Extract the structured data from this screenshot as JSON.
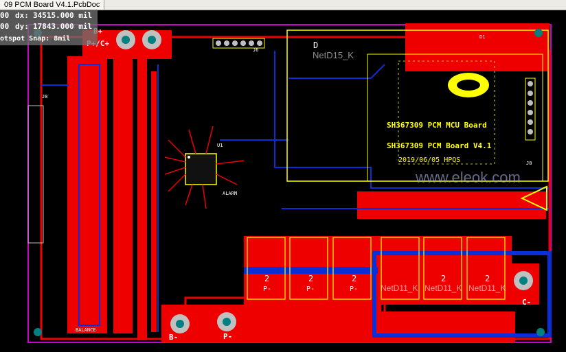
{
  "window": {
    "title": "09 PCM Board V4.1.PcbDoc"
  },
  "hud": {
    "dx_label": "dx:",
    "dx_value": "34515.000 mil",
    "dy_label": "dy:",
    "dy_value": "17843.000 mil",
    "row1_prefix": "00",
    "row2_prefix": "00",
    "snap": "otspot Snap: 8mil"
  },
  "silkscreen": {
    "b_plus": "B+",
    "p_plus_c_plus": "P+/C+",
    "b_minus": "B-",
    "p_minus": "P-",
    "c_minus": "C-",
    "board_title_1": "SH367309 PCM MCU Board",
    "board_title_2": "SH367309 PCM Board V4.1",
    "board_date": "2019/06/05 HPQS",
    "balance": "BALANCE",
    "alarm": "ALARM",
    "fet_label": "P-",
    "fet_number": "2",
    "j_left": "J8",
    "j_right": "J8",
    "j_top": "J6",
    "u_main": "U1",
    "d1": "D1",
    "d_big": "D",
    "watermark": "www.eleok.com"
  },
  "nets": {
    "net_top": "NetD15_K",
    "net_bottom_1": "NetD11_K",
    "net_bottom_2": "NetD11_K",
    "net_bottom_3": "NetD11_K"
  },
  "colors": {
    "board_bg": "#000000",
    "top_copper": "#ee0000",
    "bottom_copper": "#0b2fd6",
    "silk": "#ffff00",
    "pad": "#c0c0c0",
    "outline": "#cc00cc",
    "via_hole": "#008080"
  },
  "icons": [
    "mounting-hole-icon",
    "logo-icon",
    "warning-triangle-icon"
  ]
}
